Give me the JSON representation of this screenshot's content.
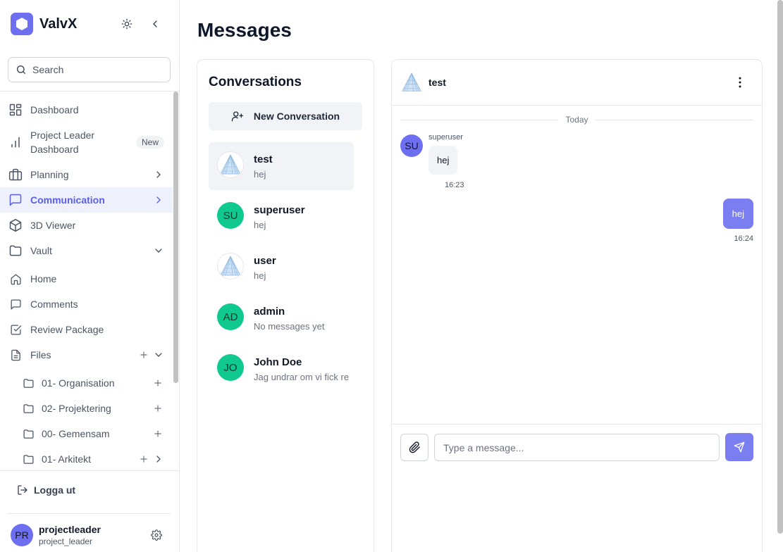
{
  "brand": {
    "name": "ValvX",
    "accent": "#6d6ff0"
  },
  "sidebar": {
    "search_placeholder": "Search",
    "items": [
      {
        "label": "Dashboard",
        "icon": "dashboard-icon"
      },
      {
        "label": "Project Leader Dashboard",
        "line1": "Project Leader",
        "line2": "Dashboard",
        "badge": "New",
        "icon": "bar-chart-icon"
      },
      {
        "label": "Planning",
        "icon": "briefcase-icon"
      },
      {
        "label": "Communication",
        "icon": "message-square-icon",
        "active": true
      },
      {
        "label": "3D Viewer",
        "icon": "cube-icon"
      },
      {
        "label": "Vault",
        "icon": "folder-icon"
      },
      {
        "label": "Home",
        "icon": "home-icon"
      },
      {
        "label": "Comments",
        "icon": "comment-icon"
      },
      {
        "label": "Review Package",
        "icon": "check-square-icon"
      },
      {
        "label": "Files",
        "icon": "file-icon"
      }
    ],
    "folders": [
      {
        "label": "01- Organisation"
      },
      {
        "label": "02- Projektering"
      },
      {
        "label": "00- Gemensam"
      },
      {
        "label": "01- Arkitekt"
      }
    ],
    "logout_label": "Logga ut",
    "user": {
      "initials": "PR",
      "name": "projectleader",
      "role": "project_leader"
    }
  },
  "main": {
    "title": "Messages",
    "conversations": {
      "title": "Conversations",
      "new_button": "New Conversation",
      "items": [
        {
          "name": "test",
          "preview": "hej",
          "avatar": "pyramid",
          "selected": true
        },
        {
          "name": "superuser",
          "preview": "hej",
          "initials": "SU"
        },
        {
          "name": "user",
          "preview": "hej",
          "avatar": "pyramid"
        },
        {
          "name": "admin",
          "preview": "No messages yet",
          "initials": "AD"
        },
        {
          "name": "John Doe",
          "preview": "Jag undrar om vi fick re",
          "initials": "JO"
        }
      ]
    },
    "chat": {
      "name": "test",
      "day_label": "Today",
      "messages": [
        {
          "sender": "superuser",
          "initials": "SU",
          "text": "hej",
          "time": "16:23",
          "direction": "in"
        },
        {
          "text": "hej",
          "time": "16:24",
          "direction": "out"
        }
      ],
      "input_placeholder": "Type a message..."
    }
  }
}
